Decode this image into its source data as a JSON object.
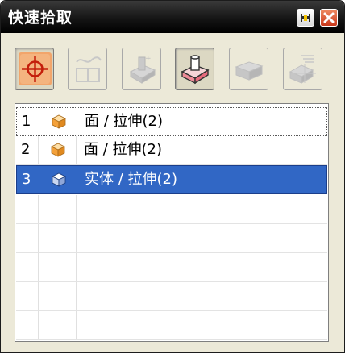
{
  "window": {
    "title": "快速拾取"
  },
  "titlebar_buttons": [
    {
      "name": "pin",
      "icon": "pin-icon"
    },
    {
      "name": "close",
      "icon": "close-icon",
      "glyph": "✕"
    }
  ],
  "toolbar": {
    "items": [
      {
        "name": "all",
        "icon": "crosshair-icon",
        "active": true
      },
      {
        "name": "curve",
        "icon": "curve-icon",
        "active": false
      },
      {
        "name": "edge",
        "icon": "edge-icon",
        "active": false
      },
      {
        "name": "face",
        "icon": "face-icon",
        "active": true
      },
      {
        "name": "body",
        "icon": "body-icon",
        "active": false
      },
      {
        "name": "feature",
        "icon": "feature-icon",
        "active": false
      }
    ]
  },
  "list": {
    "items": [
      {
        "index": "1",
        "label": "面 / 拉伸(2)",
        "icon": "face-cube-icon",
        "selected": false,
        "focused": true
      },
      {
        "index": "2",
        "label": "面 / 拉伸(2)",
        "icon": "face-cube-icon",
        "selected": false,
        "focused": false
      },
      {
        "index": "3",
        "label": "实体 / 拉伸(2)",
        "icon": "solid-body-icon",
        "selected": true,
        "focused": false
      }
    ]
  },
  "colors": {
    "titlebar": "#1a1a1a",
    "selection": "#3167c5",
    "accent_orange": "#e8733b",
    "close_red": "#d04a25"
  }
}
